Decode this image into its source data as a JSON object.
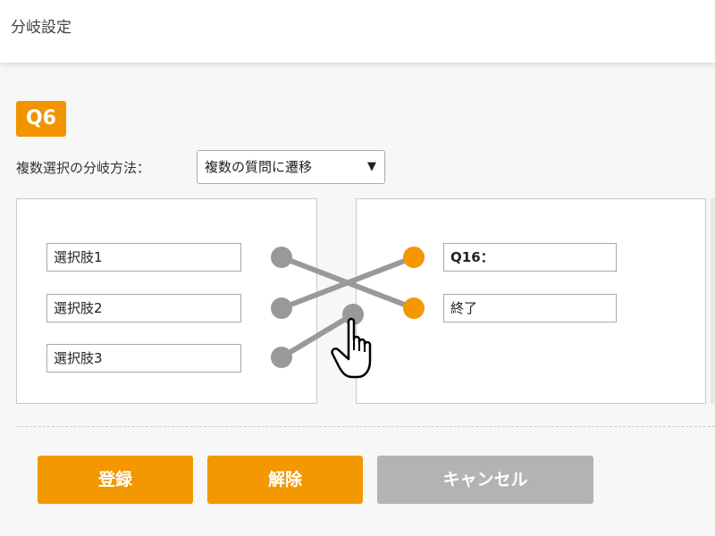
{
  "header": {
    "title": "分岐設定"
  },
  "question": {
    "badge": "Q6"
  },
  "branch_method": {
    "label": "複数選択の分岐方法：",
    "selected": "複数の質問に遷移",
    "arrow_icon": "triangle-down-icon"
  },
  "choices": [
    {
      "label": "選択肢1"
    },
    {
      "label": "選択肢2"
    },
    {
      "label": "選択肢3"
    }
  ],
  "targets": [
    {
      "label": "Q16："
    },
    {
      "label": "終了"
    }
  ],
  "buttons": {
    "register": "登録",
    "release": "解除",
    "cancel": "キャンセル"
  },
  "colors": {
    "accent": "#f39800",
    "connector_gray": "#999999",
    "disabled": "#b3b3b3"
  },
  "icons": {
    "cursor": "hand-pointer-icon"
  }
}
